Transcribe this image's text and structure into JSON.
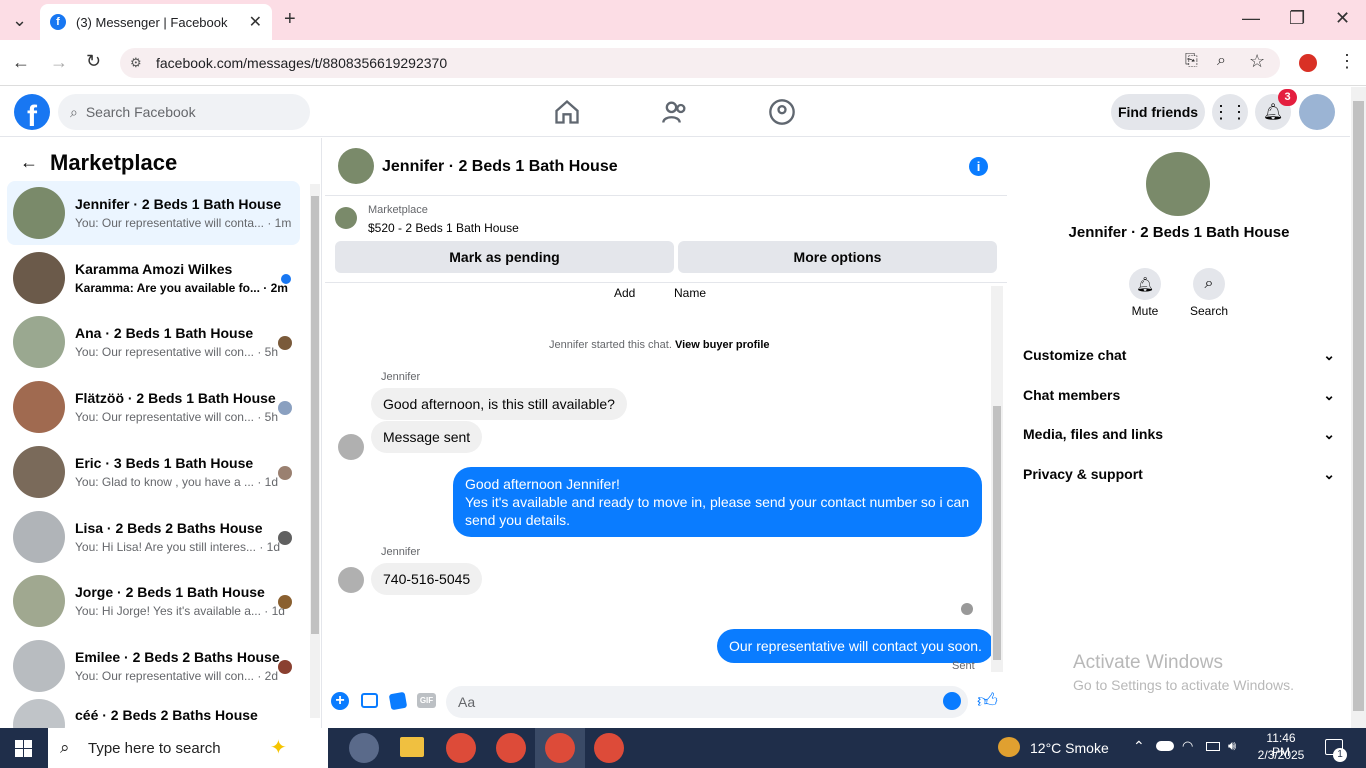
{
  "browser": {
    "tab_title": "(3) Messenger | Facebook",
    "url": "facebook.com/messages/t/8808356619292370"
  },
  "fb": {
    "search_placeholder": "Search Facebook",
    "find_friends": "Find friends",
    "notif_count": "3"
  },
  "left": {
    "title": "Marketplace",
    "conversations": [
      {
        "name": "Jennifer · 2 Beds 1 Bath House",
        "snippet": "You: Our representative will conta... · 1m",
        "color": "#7a8a6a"
      },
      {
        "name": "Karamma Amozi Wilkes",
        "snippet": "Karamma: Are you available fo... · 2m",
        "color": "#6b5a4a"
      },
      {
        "name": "Ana · 2 Beds 1 Bath House",
        "snippet": "You: Our representative will con... · 5h",
        "color": "#9aa890"
      },
      {
        "name": "Flätzöö · 2 Beds 1 Bath House",
        "snippet": "You: Our representative will con... · 5h",
        "color": "#a06a50"
      },
      {
        "name": "Eric · 3 Beds 1 Bath House",
        "snippet": "You: Glad to know , you have a ... · 1d",
        "color": "#7a6a5a"
      },
      {
        "name": "Lisa · 2 Beds 2 Baths House",
        "snippet": "You: Hi Lisa! Are you still interes... · 1d",
        "color": "#b0b4b8"
      },
      {
        "name": "Jorge · 2 Beds 1 Bath House",
        "snippet": "You: Hi Jorge! Yes it's available a... · 1d",
        "color": "#a0a890"
      },
      {
        "name": "Emilee · 2 Beds 2 Baths House",
        "snippet": "You: Our representative will con... · 2d",
        "color": "#b8bcc0"
      },
      {
        "name": "céé · 2 Beds 2 Baths House",
        "snippet": "",
        "color": "#c0c4c8"
      }
    ]
  },
  "chat": {
    "header_title": "Jennifer · 2 Beds 1 Bath House",
    "listing_label": "Marketplace",
    "listing_title": "$520 - 2 Beds 1 Bath House",
    "btn_pending": "Mark as pending",
    "btn_more": "More options",
    "add_label": "Add",
    "name_label": "Name",
    "started_text": "Jennifer started this chat.",
    "buyer_profile": "View buyer profile",
    "sender1": "Jennifer",
    "msg1": "Good afternoon, is this still available?",
    "msg2": "Message sent",
    "out1_line1": "Good afternoon Jennifer!",
    "out1_line2": "Yes it's available and ready to move in, please send your contact number so i can send you details.",
    "sender2": "Jennifer",
    "msg3": "740-516-5045",
    "out2": "Our representative will contact you soon.",
    "sent_label": "Sent",
    "input_placeholder": "Aa"
  },
  "right": {
    "name": "Jennifer · 2 Beds 1 Bath House",
    "mute": "Mute",
    "search": "Search",
    "sections": [
      "Customize chat",
      "Chat members",
      "Media, files and links",
      "Privacy & support"
    ],
    "watermark_title": "Activate Windows",
    "watermark_sub": "Go to Settings to activate Windows."
  },
  "taskbar": {
    "search_placeholder": "Type here to search",
    "weather": "12°C  Smoke",
    "time": "11:46 PM",
    "date": "2/3/2025",
    "notif": "1"
  }
}
